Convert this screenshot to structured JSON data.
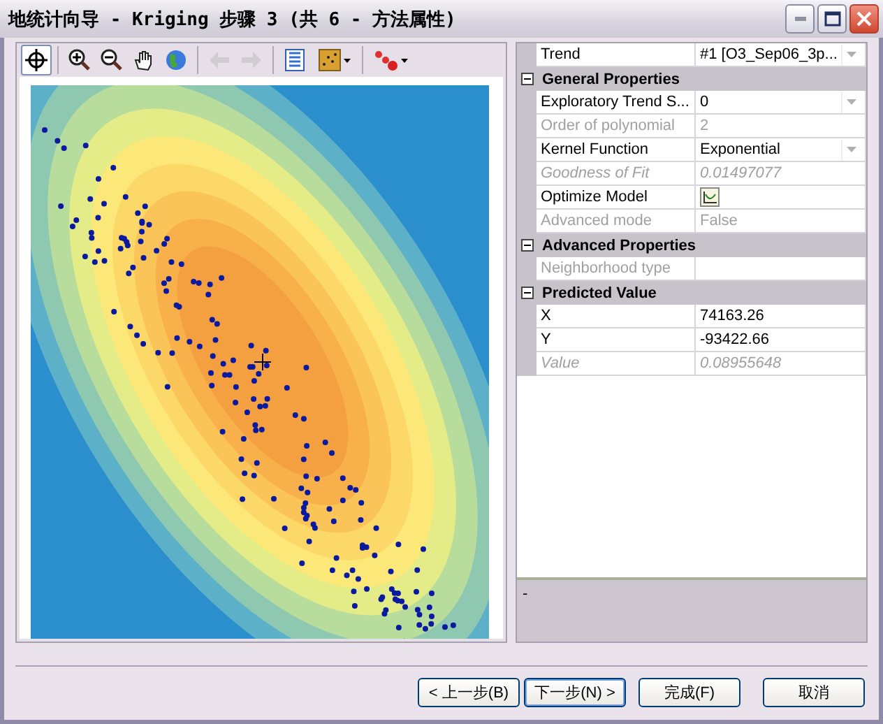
{
  "window": {
    "title": "地统计向导 - Kriging 步骤 3 (共 6 - 方法属性)"
  },
  "toolbar": [
    {
      "kind": "locate",
      "pressed": true,
      "disabled": false
    },
    {
      "kind": "zoom_in",
      "pressed": false,
      "disabled": false
    },
    {
      "kind": "zoom_out",
      "pressed": false,
      "disabled": false
    },
    {
      "kind": "pan",
      "pressed": false,
      "disabled": false
    },
    {
      "kind": "full_extent",
      "pressed": false,
      "disabled": false
    },
    {
      "kind": "back",
      "pressed": false,
      "disabled": true
    },
    {
      "kind": "forward",
      "pressed": false,
      "disabled": true
    },
    {
      "kind": "legend",
      "pressed": false,
      "disabled": false
    },
    {
      "kind": "layer_menu",
      "pressed": false,
      "disabled": false
    },
    {
      "kind": "points_menu",
      "pressed": false,
      "disabled": false
    }
  ],
  "property_grid": {
    "rows": [
      {
        "kind": "property",
        "name": "Trend",
        "value": "#1 [O3_Sep06_3p...",
        "disabled": false,
        "italic": false,
        "dropdown": true
      },
      {
        "kind": "category",
        "name": "General Properties",
        "expanded": true
      },
      {
        "kind": "property",
        "name": "Exploratory Trend S...",
        "value": "0",
        "disabled": false,
        "italic": false,
        "dropdown": true
      },
      {
        "kind": "property",
        "name": "Order of polynomial",
        "value": "2",
        "disabled": true,
        "italic": false,
        "dropdown": false
      },
      {
        "kind": "property",
        "name": "Kernel Function",
        "value": "Exponential",
        "disabled": false,
        "italic": false,
        "dropdown": true
      },
      {
        "kind": "property",
        "name": "Goodness of Fit",
        "value": "0.01497077",
        "disabled": true,
        "italic": true,
        "dropdown": false
      },
      {
        "kind": "action",
        "name": "Optimize Model",
        "disabled": false
      },
      {
        "kind": "property",
        "name": "Advanced mode",
        "value": "False",
        "disabled": true,
        "italic": false,
        "dropdown": false
      },
      {
        "kind": "category",
        "name": "Advanced Properties",
        "expanded": true
      },
      {
        "kind": "property",
        "name": "Neighborhood type",
        "value": "",
        "disabled": true,
        "italic": false,
        "dropdown": false
      },
      {
        "kind": "category",
        "name": "Predicted Value",
        "expanded": true
      },
      {
        "kind": "property",
        "name": "X",
        "value": "74163.26",
        "disabled": false,
        "italic": false,
        "dropdown": false
      },
      {
        "kind": "property",
        "name": "Y",
        "value": "-93422.66",
        "disabled": false,
        "italic": false,
        "dropdown": false
      },
      {
        "kind": "property",
        "name": "Value",
        "value": "0.08955648",
        "disabled": true,
        "italic": true,
        "dropdown": false
      }
    ],
    "description": "-"
  },
  "buttons": [
    {
      "label": "< 上一步(B)",
      "focused": false
    },
    {
      "label": "下一步(N) >",
      "focused": true
    },
    {
      "label": "完成(F)",
      "focused": false
    },
    {
      "label": "取消",
      "focused": false
    }
  ]
}
